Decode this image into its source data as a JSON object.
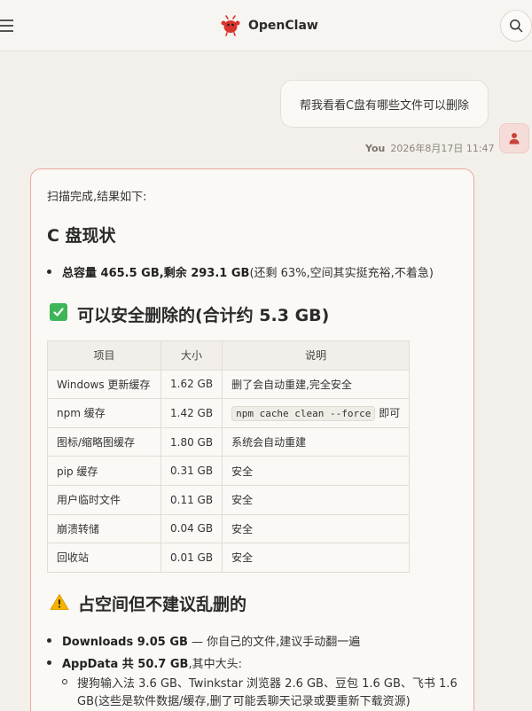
{
  "header": {
    "title": "OpenClaw",
    "colors": {
      "brand_red": "#d9332e"
    }
  },
  "user_message": {
    "text": "帮我看看C盘有哪些文件可以删除",
    "author": "You",
    "timestamp": "2026年8月17日 11:47"
  },
  "assistant": {
    "intro": "扫描完成,结果如下:",
    "section1_title": "C 盘现状",
    "summary_bold": "总容量 465.5 GB,剩余 293.1 GB",
    "summary_rest": "(还剩 63%,空间其实挺充裕,不着急)",
    "section2_title": "可以安全删除的(合计约 5.3 GB)",
    "table": {
      "headers": [
        "项目",
        "大小",
        "说明"
      ],
      "rows": [
        {
          "item": "Windows 更新缓存",
          "size": "1.62 GB",
          "note": "删了会自动重建,完全安全"
        },
        {
          "item": "npm 缓存",
          "size": "1.42 GB",
          "note_code": "npm cache clean --force",
          "note_suffix": "即可"
        },
        {
          "item": "图标/缩略图缓存",
          "size": "1.80 GB",
          "note": "系统会自动重建"
        },
        {
          "item": "pip 缓存",
          "size": "0.31 GB",
          "note": "安全"
        },
        {
          "item": "用户临时文件",
          "size": "0.11 GB",
          "note": "安全"
        },
        {
          "item": "崩溃转储",
          "size": "0.04 GB",
          "note": "安全"
        },
        {
          "item": "回收站",
          "size": "0.01 GB",
          "note": "安全"
        }
      ]
    },
    "section3_title": "占空间但不建议乱删的",
    "bullets": [
      {
        "bold": "Downloads 9.05 GB",
        "rest": " — 你自己的文件,建议手动翻一遍"
      },
      {
        "bold": "AppData 共 50.7 GB",
        "rest": ",其中大头:"
      }
    ],
    "sub_bullet_line1": "搜狗输入法 3.6 GB、Twinkstar 浏览器 2.6 GB、豆包 1.6 GB、飞书 1.6",
    "sub_bullet_line2": "GB(这些是软件数据/缓存,删了可能丢聊天记录或要重新下载资源)"
  }
}
